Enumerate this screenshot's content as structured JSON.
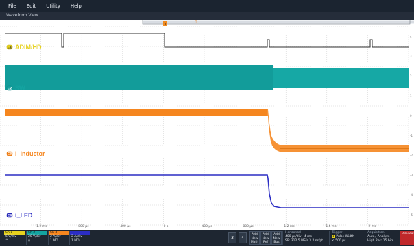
{
  "menu": {
    "items": [
      "File",
      "Edit",
      "Utility",
      "Help"
    ]
  },
  "waveform_view": {
    "title": "Waveform View"
  },
  "trigger_marker": {
    "label": "T"
  },
  "channels": [
    {
      "label": "ADIM/HD",
      "color": "#e6d11e",
      "badge": "C1"
    },
    {
      "label": "SW",
      "color": "#14a3a0",
      "badge": "C2"
    },
    {
      "label": "i_inductor",
      "color": "#f5861f",
      "badge": "C3"
    },
    {
      "label": "i_LED",
      "color": "#2b2dc4",
      "badge": "C4"
    }
  ],
  "right_ticks": [
    "4",
    "3",
    "2",
    "1",
    "0",
    "-1",
    "-2",
    "-3",
    "-4",
    "-5"
  ],
  "x_ticks": [
    "-1.2 ms",
    "-800 µs",
    "-400 µs",
    "0 s",
    "400 µs",
    "800 µs",
    "1.2 ms",
    "1.6 ms",
    "2 ms"
  ],
  "bottom": {
    "ch1": {
      "tab": "Ch 1",
      "line1": "5 V/div",
      "line2": "^"
    },
    "ch2": {
      "tab": "Ch 2",
      "line1": "20 V/div",
      "line2": "/\\"
    },
    "ch3": {
      "tab": "Ch 3",
      "line1": "2 A/div",
      "line2": "1 MΩ"
    },
    "ch4": {
      "tab": "",
      "line1": "2 A/div",
      "line2": "1 MΩ"
    },
    "num3": "3",
    "num4": "4",
    "add_math": {
      "l1": "Add",
      "l2": "New",
      "l3": "Math"
    },
    "add_ref": {
      "l1": "Add",
      "l2": "New",
      "l3": "Ref"
    },
    "add_bus": {
      "l1": "Add",
      "l2": "New",
      "l3": "Bus"
    },
    "horizontal": {
      "title": "Horizontal",
      "l1a": "400 µs/div",
      "l1b": "4 ms",
      "l2a": "SR: 312.5 MS/s",
      "l2b": "3.2 ns/pt"
    },
    "trigger": {
      "title": "Trigger",
      "badge": "1",
      "type": "Pulse Width",
      "cond": "< 500 µs"
    },
    "acquisition": {
      "title": "Acquisition",
      "l1a": "Auto,",
      "l1b": "Analyze",
      "l2": "High Res: 15 bits"
    },
    "preview": "Preview"
  },
  "colors": {
    "grid": "#c9c9c9",
    "bg": "#ffffff",
    "top": "#1b2430"
  }
}
